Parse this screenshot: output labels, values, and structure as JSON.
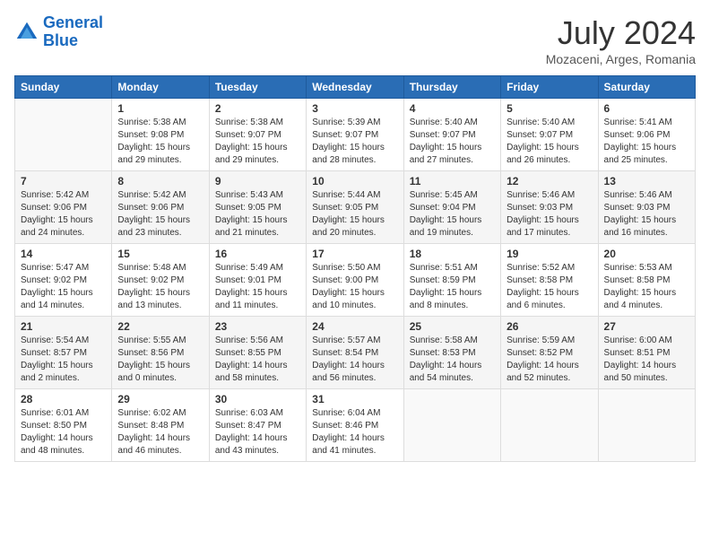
{
  "header": {
    "logo_line1": "General",
    "logo_line2": "Blue",
    "month_year": "July 2024",
    "location": "Mozaceni, Arges, Romania"
  },
  "weekdays": [
    "Sunday",
    "Monday",
    "Tuesday",
    "Wednesday",
    "Thursday",
    "Friday",
    "Saturday"
  ],
  "weeks": [
    [
      {
        "day": "",
        "sunrise": "",
        "sunset": "",
        "daylight": ""
      },
      {
        "day": "1",
        "sunrise": "Sunrise: 5:38 AM",
        "sunset": "Sunset: 9:08 PM",
        "daylight": "Daylight: 15 hours and 29 minutes."
      },
      {
        "day": "2",
        "sunrise": "Sunrise: 5:38 AM",
        "sunset": "Sunset: 9:07 PM",
        "daylight": "Daylight: 15 hours and 29 minutes."
      },
      {
        "day": "3",
        "sunrise": "Sunrise: 5:39 AM",
        "sunset": "Sunset: 9:07 PM",
        "daylight": "Daylight: 15 hours and 28 minutes."
      },
      {
        "day": "4",
        "sunrise": "Sunrise: 5:40 AM",
        "sunset": "Sunset: 9:07 PM",
        "daylight": "Daylight: 15 hours and 27 minutes."
      },
      {
        "day": "5",
        "sunrise": "Sunrise: 5:40 AM",
        "sunset": "Sunset: 9:07 PM",
        "daylight": "Daylight: 15 hours and 26 minutes."
      },
      {
        "day": "6",
        "sunrise": "Sunrise: 5:41 AM",
        "sunset": "Sunset: 9:06 PM",
        "daylight": "Daylight: 15 hours and 25 minutes."
      }
    ],
    [
      {
        "day": "7",
        "sunrise": "Sunrise: 5:42 AM",
        "sunset": "Sunset: 9:06 PM",
        "daylight": "Daylight: 15 hours and 24 minutes."
      },
      {
        "day": "8",
        "sunrise": "Sunrise: 5:42 AM",
        "sunset": "Sunset: 9:06 PM",
        "daylight": "Daylight: 15 hours and 23 minutes."
      },
      {
        "day": "9",
        "sunrise": "Sunrise: 5:43 AM",
        "sunset": "Sunset: 9:05 PM",
        "daylight": "Daylight: 15 hours and 21 minutes."
      },
      {
        "day": "10",
        "sunrise": "Sunrise: 5:44 AM",
        "sunset": "Sunset: 9:05 PM",
        "daylight": "Daylight: 15 hours and 20 minutes."
      },
      {
        "day": "11",
        "sunrise": "Sunrise: 5:45 AM",
        "sunset": "Sunset: 9:04 PM",
        "daylight": "Daylight: 15 hours and 19 minutes."
      },
      {
        "day": "12",
        "sunrise": "Sunrise: 5:46 AM",
        "sunset": "Sunset: 9:03 PM",
        "daylight": "Daylight: 15 hours and 17 minutes."
      },
      {
        "day": "13",
        "sunrise": "Sunrise: 5:46 AM",
        "sunset": "Sunset: 9:03 PM",
        "daylight": "Daylight: 15 hours and 16 minutes."
      }
    ],
    [
      {
        "day": "14",
        "sunrise": "Sunrise: 5:47 AM",
        "sunset": "Sunset: 9:02 PM",
        "daylight": "Daylight: 15 hours and 14 minutes."
      },
      {
        "day": "15",
        "sunrise": "Sunrise: 5:48 AM",
        "sunset": "Sunset: 9:02 PM",
        "daylight": "Daylight: 15 hours and 13 minutes."
      },
      {
        "day": "16",
        "sunrise": "Sunrise: 5:49 AM",
        "sunset": "Sunset: 9:01 PM",
        "daylight": "Daylight: 15 hours and 11 minutes."
      },
      {
        "day": "17",
        "sunrise": "Sunrise: 5:50 AM",
        "sunset": "Sunset: 9:00 PM",
        "daylight": "Daylight: 15 hours and 10 minutes."
      },
      {
        "day": "18",
        "sunrise": "Sunrise: 5:51 AM",
        "sunset": "Sunset: 8:59 PM",
        "daylight": "Daylight: 15 hours and 8 minutes."
      },
      {
        "day": "19",
        "sunrise": "Sunrise: 5:52 AM",
        "sunset": "Sunset: 8:58 PM",
        "daylight": "Daylight: 15 hours and 6 minutes."
      },
      {
        "day": "20",
        "sunrise": "Sunrise: 5:53 AM",
        "sunset": "Sunset: 8:58 PM",
        "daylight": "Daylight: 15 hours and 4 minutes."
      }
    ],
    [
      {
        "day": "21",
        "sunrise": "Sunrise: 5:54 AM",
        "sunset": "Sunset: 8:57 PM",
        "daylight": "Daylight: 15 hours and 2 minutes."
      },
      {
        "day": "22",
        "sunrise": "Sunrise: 5:55 AM",
        "sunset": "Sunset: 8:56 PM",
        "daylight": "Daylight: 15 hours and 0 minutes."
      },
      {
        "day": "23",
        "sunrise": "Sunrise: 5:56 AM",
        "sunset": "Sunset: 8:55 PM",
        "daylight": "Daylight: 14 hours and 58 minutes."
      },
      {
        "day": "24",
        "sunrise": "Sunrise: 5:57 AM",
        "sunset": "Sunset: 8:54 PM",
        "daylight": "Daylight: 14 hours and 56 minutes."
      },
      {
        "day": "25",
        "sunrise": "Sunrise: 5:58 AM",
        "sunset": "Sunset: 8:53 PM",
        "daylight": "Daylight: 14 hours and 54 minutes."
      },
      {
        "day": "26",
        "sunrise": "Sunrise: 5:59 AM",
        "sunset": "Sunset: 8:52 PM",
        "daylight": "Daylight: 14 hours and 52 minutes."
      },
      {
        "day": "27",
        "sunrise": "Sunrise: 6:00 AM",
        "sunset": "Sunset: 8:51 PM",
        "daylight": "Daylight: 14 hours and 50 minutes."
      }
    ],
    [
      {
        "day": "28",
        "sunrise": "Sunrise: 6:01 AM",
        "sunset": "Sunset: 8:50 PM",
        "daylight": "Daylight: 14 hours and 48 minutes."
      },
      {
        "day": "29",
        "sunrise": "Sunrise: 6:02 AM",
        "sunset": "Sunset: 8:48 PM",
        "daylight": "Daylight: 14 hours and 46 minutes."
      },
      {
        "day": "30",
        "sunrise": "Sunrise: 6:03 AM",
        "sunset": "Sunset: 8:47 PM",
        "daylight": "Daylight: 14 hours and 43 minutes."
      },
      {
        "day": "31",
        "sunrise": "Sunrise: 6:04 AM",
        "sunset": "Sunset: 8:46 PM",
        "daylight": "Daylight: 14 hours and 41 minutes."
      },
      {
        "day": "",
        "sunrise": "",
        "sunset": "",
        "daylight": ""
      },
      {
        "day": "",
        "sunrise": "",
        "sunset": "",
        "daylight": ""
      },
      {
        "day": "",
        "sunrise": "",
        "sunset": "",
        "daylight": ""
      }
    ]
  ]
}
